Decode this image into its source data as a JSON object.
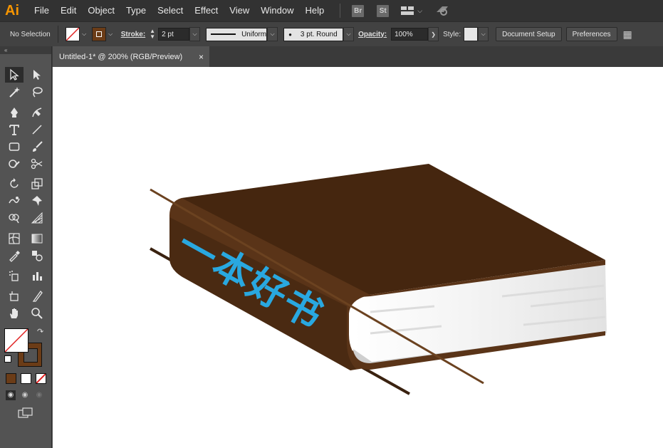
{
  "app": {
    "logo": "Ai"
  },
  "menu": [
    "File",
    "Edit",
    "Object",
    "Type",
    "Select",
    "Effect",
    "View",
    "Window",
    "Help"
  ],
  "menu_buttons": {
    "bridge": "Br",
    "stock": "St"
  },
  "control": {
    "selection": "No Selection",
    "stroke_label": "Stroke:",
    "stroke_value": "2 pt",
    "profile": "Uniform",
    "brush": "3 pt. Round",
    "opacity_label": "Opacity:",
    "opacity_value": "100%",
    "style_label": "Style:",
    "document_setup": "Document Setup",
    "preferences": "Preferences"
  },
  "document": {
    "tab_title": "Untitled-1* @ 200% (RGB/Preview)",
    "close": "×"
  },
  "artwork": {
    "book_title": "一本好书"
  },
  "colors": {
    "app_bg": "#535353",
    "menubar": "#323232",
    "logo": "#f79500",
    "book_cover": "#45260f",
    "book_spine": "#5a3418",
    "strap": "#6b4220",
    "title_blue": "#29a8e0",
    "fill_swatch": "#ffffff",
    "stroke_swatch": "#6b3c17"
  },
  "tool_icons": [
    "selection-tool-icon",
    "direct-selection-tool-icon",
    "magic-wand-tool-icon",
    "lasso-tool-icon",
    "pen-tool-icon",
    "curvature-tool-icon",
    "type-tool-icon",
    "line-segment-tool-icon",
    "rectangle-tool-icon",
    "paintbrush-tool-icon",
    "shaper-tool-icon",
    "scissors-tool-icon",
    "rotate-tool-icon",
    "scale-tool-icon",
    "warp-tool-icon",
    "puppet-warp-tool-icon",
    "shape-builder-tool-icon",
    "perspective-grid-tool-icon",
    "mesh-tool-icon",
    "gradient-tool-icon",
    "eyedropper-tool-icon",
    "blend-tool-icon",
    "symbol-sprayer-tool-icon",
    "column-graph-tool-icon",
    "artboard-tool-icon",
    "slice-tool-icon",
    "hand-tool-icon",
    "zoom-tool-icon"
  ]
}
